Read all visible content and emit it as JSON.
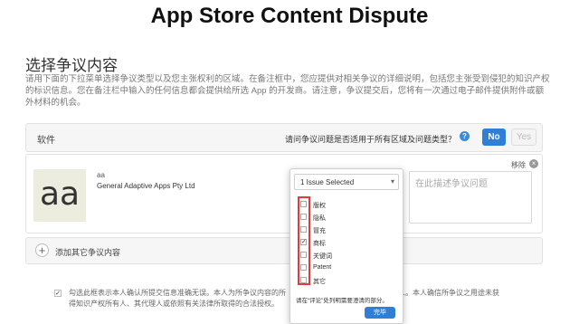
{
  "page": {
    "title": "App Store Content Dispute",
    "section_title": "选择争议内容",
    "section_desc": "请用下面的下拉菜单选择争议类型以及您主张权利的区域。在备注框中，您应提供对相关争议的详细说明，包括您主张受到侵犯的知识产权的标识信息。您在备注栏中输入的任何信息都会提供给所选 App 的开发商。请注意，争议提交后，您将有一次通过电子邮件提供附件或额外材料的机会。"
  },
  "software_panel": {
    "label": "软件",
    "question": "请问争议问题是否适用于所有区域及问题类型？",
    "help": "?",
    "no_label": "No",
    "yes_label": "Yes"
  },
  "app_panel": {
    "thumb_text": "aa",
    "app_name": "aa",
    "developer": "General Adaptive Apps Pty Ltd",
    "remove_label": "移除",
    "remove_icon": "×",
    "description_placeholder": "在此描述争议问题"
  },
  "dropdown": {
    "selected": "1 Issue Selected",
    "arrow": "▾",
    "items": [
      {
        "label": "版权",
        "checked": false
      },
      {
        "label": "隐私",
        "checked": false
      },
      {
        "label": "冒充",
        "checked": false
      },
      {
        "label": "商标",
        "checked": true
      },
      {
        "label": "关键词",
        "checked": false
      },
      {
        "label": "Patent",
        "checked": false
      },
      {
        "label": "其它",
        "checked": false
      }
    ],
    "note": "请在“评论”处列明需要澄清的部分。",
    "done_label": "完毕"
  },
  "add_panel": {
    "icon": "+",
    "label": "添加其它争议内容"
  },
  "consent": {
    "checked": true,
    "text_left": "勾选此框表示本人确认所提交信息准确无误。本人为所争议内容的所",
    "text_right": "或代理人。本人确信所争议之用途未获",
    "text_line2": "得知识产权所有人、其代理人或依照有关法律所取得的合法授权。"
  }
}
